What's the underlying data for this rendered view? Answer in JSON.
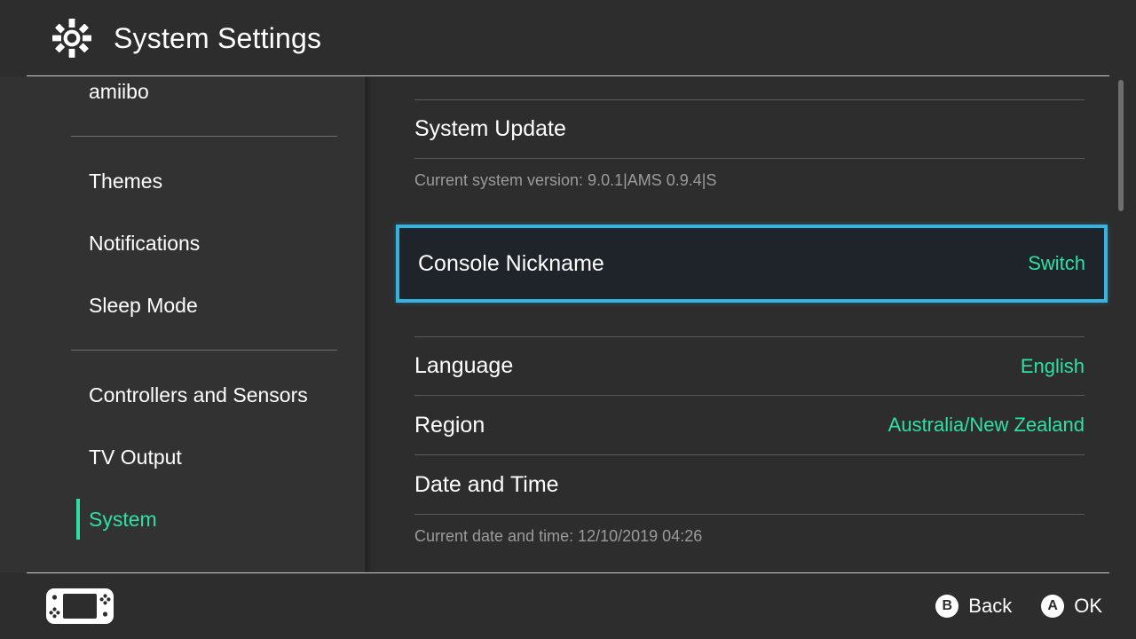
{
  "header": {
    "title": "System Settings",
    "icon": "gear-icon"
  },
  "sidebar": {
    "items": [
      {
        "label": "amiibo",
        "active": false,
        "clipped": true
      },
      {
        "label": "Themes",
        "active": false
      },
      {
        "label": "Notifications",
        "active": false
      },
      {
        "label": "Sleep Mode",
        "active": false
      },
      {
        "label": "Controllers and Sensors",
        "active": false
      },
      {
        "label": "TV Output",
        "active": false
      },
      {
        "label": "System",
        "active": true
      }
    ]
  },
  "content": {
    "rows": [
      {
        "label": "System Update",
        "value": ""
      },
      {
        "caption": "Current system version: 9.0.1|AMS 0.9.4|S"
      },
      {
        "label": "Console Nickname",
        "value": "Switch",
        "selected": true
      },
      {
        "label": "Language",
        "value": "English"
      },
      {
        "label": "Region",
        "value": "Australia/New Zealand"
      },
      {
        "label": "Date and Time",
        "value": ""
      },
      {
        "caption": "Current date and time: 12/10/2019 04:26"
      }
    ],
    "system_update_label": "System Update",
    "system_version_caption": "Current system version: 9.0.1|AMS 0.9.4|S",
    "console_nickname_label": "Console Nickname",
    "console_nickname_value": "Switch",
    "language_label": "Language",
    "language_value": "English",
    "region_label": "Region",
    "region_value": "Australia/New Zealand",
    "date_time_label": "Date and Time",
    "date_time_caption": "Current date and time: 12/10/2019 04:26"
  },
  "footer": {
    "console_icon": "handheld-console-icon",
    "actions": [
      {
        "button": "B",
        "label": "Back"
      },
      {
        "button": "A",
        "label": "OK"
      }
    ],
    "back_button_glyph": "B",
    "back_label": "Back",
    "ok_button_glyph": "A",
    "ok_label": "OK"
  },
  "colors": {
    "background": "#2d2d2d",
    "sidebar_background": "#323232",
    "accent_green": "#2ee0a6",
    "selection_border": "#35b4e2",
    "selection_fill": "#1e2429",
    "divider": "#5a5a5a",
    "caption_text": "#9b9b9b",
    "primary_text": "#ffffff"
  },
  "scrollbar": {
    "thumb_position": "top"
  }
}
